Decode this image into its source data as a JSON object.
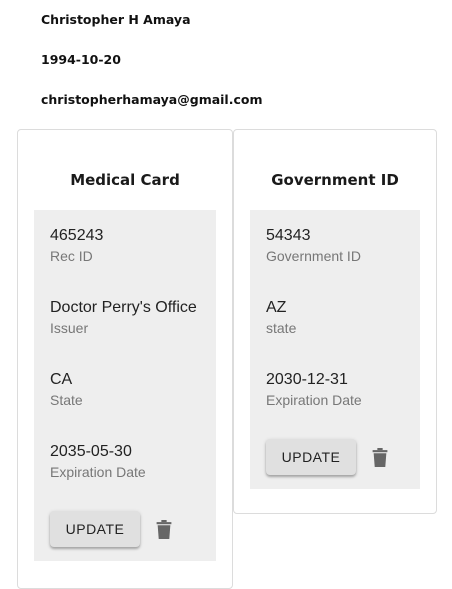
{
  "profile": {
    "name": "Christopher H Amaya",
    "dob": "1994-10-20",
    "email": "christopherhamaya@gmail.com"
  },
  "cards": [
    {
      "title": "Medical Card",
      "fields": [
        {
          "value": "465243",
          "label": "Rec ID"
        },
        {
          "value": "Doctor Perry's Office",
          "label": "Issuer"
        },
        {
          "value": "CA",
          "label": "State"
        },
        {
          "value": "2035-05-30",
          "label": "Expiration Date"
        }
      ],
      "update_label": "UPDATE",
      "delete_icon": "trash-icon"
    },
    {
      "title": "Government ID",
      "fields": [
        {
          "value": "54343",
          "label": "Government ID"
        },
        {
          "value": "AZ",
          "label": "state"
        },
        {
          "value": "2030-12-31",
          "label": "Expiration Date"
        }
      ],
      "update_label": "UPDATE",
      "delete_icon": "trash-icon"
    }
  ],
  "colors": {
    "panel_bg": "#eeeeee",
    "button_bg": "#e0e0e0",
    "icon": "#666666",
    "label": "#777777"
  }
}
